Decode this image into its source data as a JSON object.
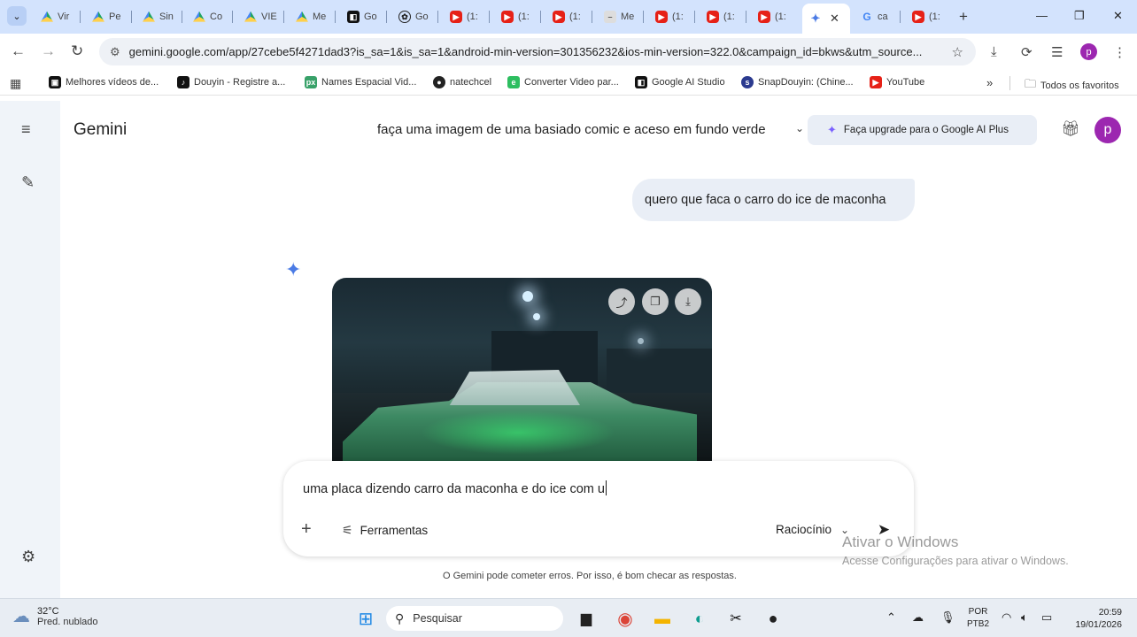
{
  "browser": {
    "tabs": [
      {
        "label": "Vir",
        "icon": "drive-icon"
      },
      {
        "label": "Pe",
        "icon": "drive-icon"
      },
      {
        "label": "Sin",
        "icon": "drive-icon"
      },
      {
        "label": "Co",
        "icon": "drive-icon"
      },
      {
        "label": "VIE",
        "icon": "drive-icon"
      },
      {
        "label": "Me",
        "icon": "drive-icon"
      },
      {
        "label": "Go",
        "icon": "ai-studio-icon"
      },
      {
        "label": "Go",
        "icon": "openai-icon"
      },
      {
        "label": "(1:",
        "icon": "youtube-icon"
      },
      {
        "label": "(1:",
        "icon": "youtube-icon"
      },
      {
        "label": "(1:",
        "icon": "youtube-icon"
      },
      {
        "label": "Me",
        "icon": "page-icon"
      },
      {
        "label": "(1:",
        "icon": "youtube-icon"
      },
      {
        "label": "(1:",
        "icon": "youtube-icon"
      },
      {
        "label": "(1:",
        "icon": "youtube-icon"
      },
      {
        "label": "",
        "icon": "gemini-icon",
        "active": true
      },
      {
        "label": "ca",
        "icon": "google-icon"
      },
      {
        "label": "(1:",
        "icon": "youtube-icon"
      }
    ],
    "url": "gemini.google.com/app/27cebe5f4271dad3?is_sa=1&is_sa=1&android-min-version=301356232&ios-min-version=322.0&campaign_id=bkws&utm_source...",
    "profile_initial": "p",
    "bookmarks": [
      {
        "label": "Melhores vídeos de...",
        "icon": "bookmark-icon"
      },
      {
        "label": "Douyin - Registre a...",
        "icon": "tiktok-icon"
      },
      {
        "label": "Names Espacial Vid...",
        "icon": "px-icon"
      },
      {
        "label": "natechcel",
        "icon": "github-icon"
      },
      {
        "label": "Converter Video par...",
        "icon": "evernote-icon"
      },
      {
        "label": "Google AI Studio",
        "icon": "ai-studio-icon"
      },
      {
        "label": "SnapDouyin: (Chine...",
        "icon": "snap-icon"
      },
      {
        "label": "YouTube",
        "icon": "youtube-icon"
      }
    ],
    "all_bookmarks_label": "Todos os favoritos"
  },
  "gemini": {
    "app_title": "Gemini",
    "chat_title": "faça uma imagem de uma basiado comic e aceso em fundo verde",
    "upgrade_label": "Faça upgrade para o Google AI Plus",
    "avatar_initial": "p",
    "user_message": "quero que faca o carro do ice de maconha",
    "composer_text": "uma placa dizendo carro da maconha e do ice com u",
    "tools_label": "Ferramentas",
    "reasoning_label": "Raciocínio",
    "disclaimer": "O Gemini pode cometer erros. Por isso, é bom checar as respostas.",
    "accent": "#4b7be5"
  },
  "watermark": {
    "title": "Ativar o Windows",
    "subtitle": "Acesse Configurações para ativar o Windows."
  },
  "taskbar": {
    "temperature": "32°C",
    "weather_desc": "Pred. nublado",
    "search_placeholder": "Pesquisar",
    "lang_1": "POR",
    "lang_2": "PTB2",
    "time": "20:59",
    "date": "19/01/2026"
  }
}
